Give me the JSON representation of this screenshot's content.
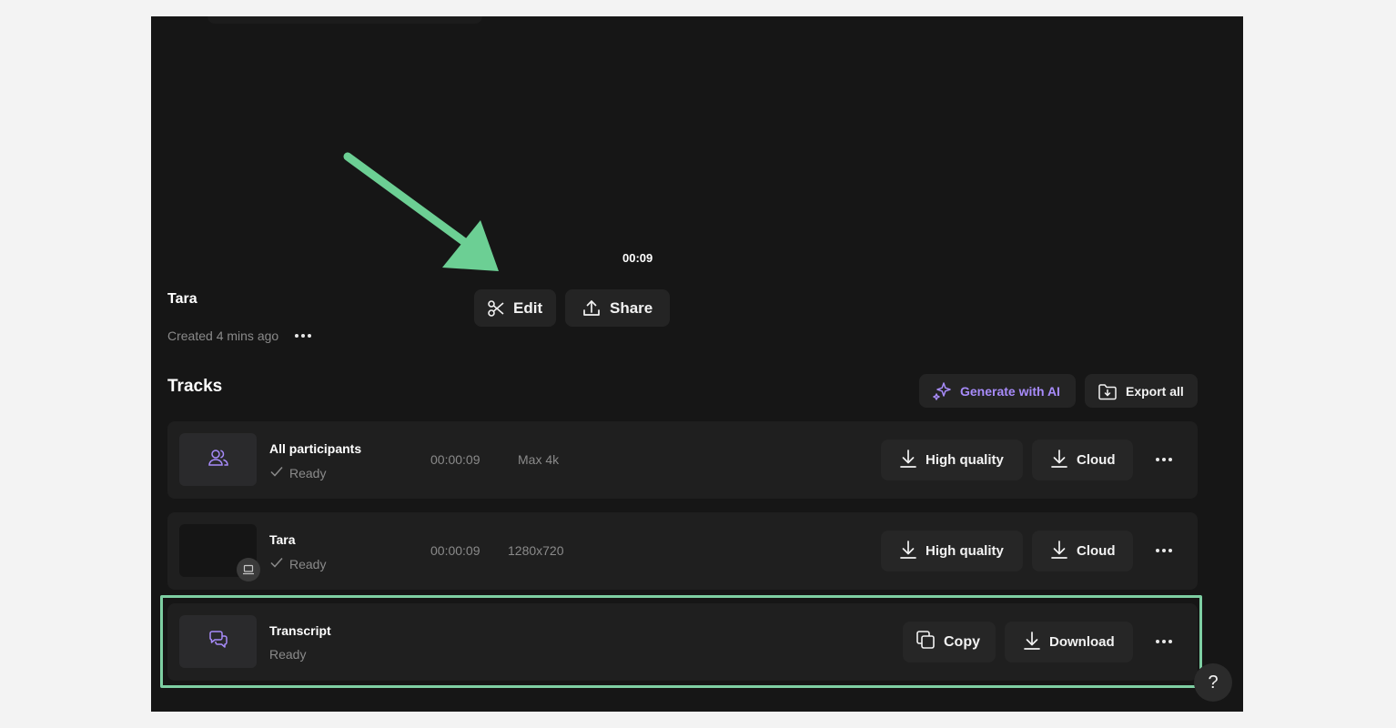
{
  "player": {
    "timestamp": "00:09"
  },
  "recording": {
    "title": "Tara",
    "created": "Created 4 mins ago",
    "edit_label": "Edit",
    "share_label": "Share"
  },
  "tracks": {
    "heading": "Tracks",
    "generate_label": "Generate with AI",
    "export_label": "Export all",
    "items": [
      {
        "name": "All participants",
        "status": "Ready",
        "duration": "00:00:09",
        "resolution": "Max 4k",
        "primary_action": "High quality",
        "secondary_action": "Cloud"
      },
      {
        "name": "Tara",
        "status": "Ready",
        "duration": "00:00:09",
        "resolution": "1280x720",
        "primary_action": "High quality",
        "secondary_action": "Cloud"
      },
      {
        "name": "Transcript",
        "status": "Ready",
        "primary_action": "Copy",
        "secondary_action": "Download"
      }
    ]
  },
  "help": {
    "label": "?"
  },
  "colors": {
    "accent_purple": "#a78bfa",
    "highlight_green": "#7ecfa3",
    "background": "#161616"
  },
  "icons": {
    "edit": "scissors-icon",
    "share": "upload-icon",
    "generate": "sparkle-icon",
    "export": "folder-download-icon",
    "download": "download-icon",
    "copy": "copy-icon",
    "participants": "users-icon",
    "transcript": "chat-bubbles-icon",
    "laptop": "laptop-icon",
    "more": "ellipsis-icon",
    "check": "check-icon"
  }
}
